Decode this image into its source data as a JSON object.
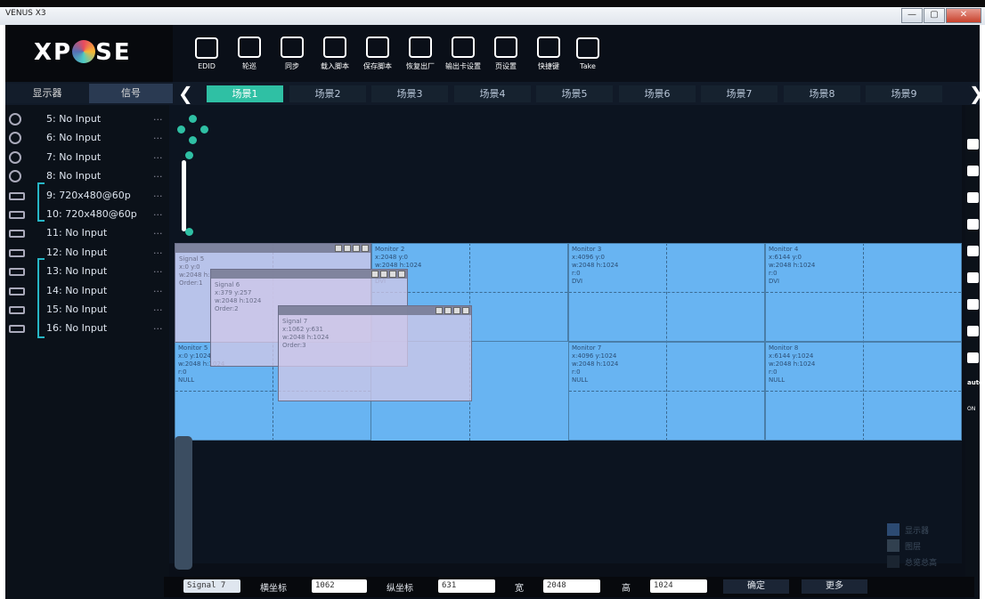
{
  "window": {
    "title": "VENUS X3",
    "min": "—",
    "max": "▢",
    "close": "✕"
  },
  "logo": {
    "text_pre": "X",
    "text_mid": "P",
    "text_post": "SE"
  },
  "toolbar": [
    {
      "id": "edid",
      "label": "EDID"
    },
    {
      "id": "polling",
      "label": "轮巡"
    },
    {
      "id": "sync",
      "label": "同步"
    },
    {
      "id": "load-script",
      "label": "载入脚本"
    },
    {
      "id": "save-script",
      "label": "保存脚本"
    },
    {
      "id": "factory-reset",
      "label": "恢复出厂"
    },
    {
      "id": "output-card",
      "label": "输出卡设置"
    },
    {
      "id": "page-settings",
      "label": "页设置"
    },
    {
      "id": "shortcuts",
      "label": "快捷键"
    },
    {
      "id": "take",
      "label": "Take"
    }
  ],
  "left_tabs": {
    "display": "显示器",
    "signal": "信号"
  },
  "scenes": [
    "场景1",
    "场景2",
    "场景3",
    "场景4",
    "场景5",
    "场景6",
    "场景7",
    "场景8",
    "场景9"
  ],
  "nav": {
    "prev": "❮",
    "next": "❯"
  },
  "signals": [
    {
      "label": "5: No Input",
      "type": "circle"
    },
    {
      "label": "6: No Input",
      "type": "circle"
    },
    {
      "label": "7: No Input",
      "type": "circle"
    },
    {
      "label": "8: No Input",
      "type": "circle"
    },
    {
      "label": "9: 720x480@60p",
      "type": "rect"
    },
    {
      "label": "10: 720x480@60p",
      "type": "rect"
    },
    {
      "label": "11: No Input",
      "type": "rect"
    },
    {
      "label": "12: No Input",
      "type": "rect"
    },
    {
      "label": "13: No Input",
      "type": "rect"
    },
    {
      "label": "14: No Input",
      "type": "rect"
    },
    {
      "label": "15: No Input",
      "type": "rect"
    },
    {
      "label": "16: No Input",
      "type": "rect"
    }
  ],
  "more_dots": "...",
  "monitors": [
    {
      "name": "Monitor 2",
      "pos": "x:2048  y:0",
      "size": "w:2048  h:1024",
      "r": "r:0",
      "type": "DVI"
    },
    {
      "name": "Monitor 3",
      "pos": "x:4096  y:0",
      "size": "w:2048  h:1024",
      "r": "r:0",
      "type": "DVI"
    },
    {
      "name": "Monitor 4",
      "pos": "x:6144  y:0",
      "size": "w:2048  h:1024",
      "r": "r:0",
      "type": "DVI"
    },
    {
      "name": "Monitor 5",
      "pos": "x:0  y:1024",
      "size": "w:2048  h:1024",
      "r": "r:0",
      "type": "NULL"
    },
    {
      "name": "Monitor 7",
      "pos": "x:4096  y:1024",
      "size": "w:2048  h:1024",
      "r": "r:0",
      "type": "NULL"
    },
    {
      "name": "Monitor 8",
      "pos": "x:6144  y:1024",
      "size": "w:2048  h:1024",
      "r": "r:0",
      "type": "NULL"
    }
  ],
  "windows": [
    {
      "name": "Signal 5",
      "pos": "x:0  y:0",
      "size": "w:2048  h:",
      "order": "Order:1"
    },
    {
      "name": "Signal 6",
      "pos": "x:379  y:257",
      "size": "w:2048  h:1024",
      "order": "Order:2"
    },
    {
      "name": "Signal 7",
      "pos": "x:1062  y:631",
      "size": "w:2048  h:1024",
      "order": "Order:3"
    }
  ],
  "legend": [
    "显示器",
    "图层",
    "总览总高"
  ],
  "bottom": {
    "signal": "Signal 7",
    "x_label": "横坐标",
    "x_value": "1062",
    "y_label": "纵坐标",
    "y_value": "631",
    "w_label": "宽",
    "w_value": "2048",
    "h_label": "高",
    "h_value": "1024",
    "confirm": "确定",
    "more": "更多"
  },
  "right_icons": [
    "monitor-icon",
    "monitor-icon",
    "monitor-icon",
    "monitor-icon",
    "image-icon",
    "image-icon",
    "close-icon",
    "copy-icon",
    "paste-icon",
    "auto-icon",
    "on-icon"
  ],
  "right_auto": "auto",
  "right_on": "ON"
}
